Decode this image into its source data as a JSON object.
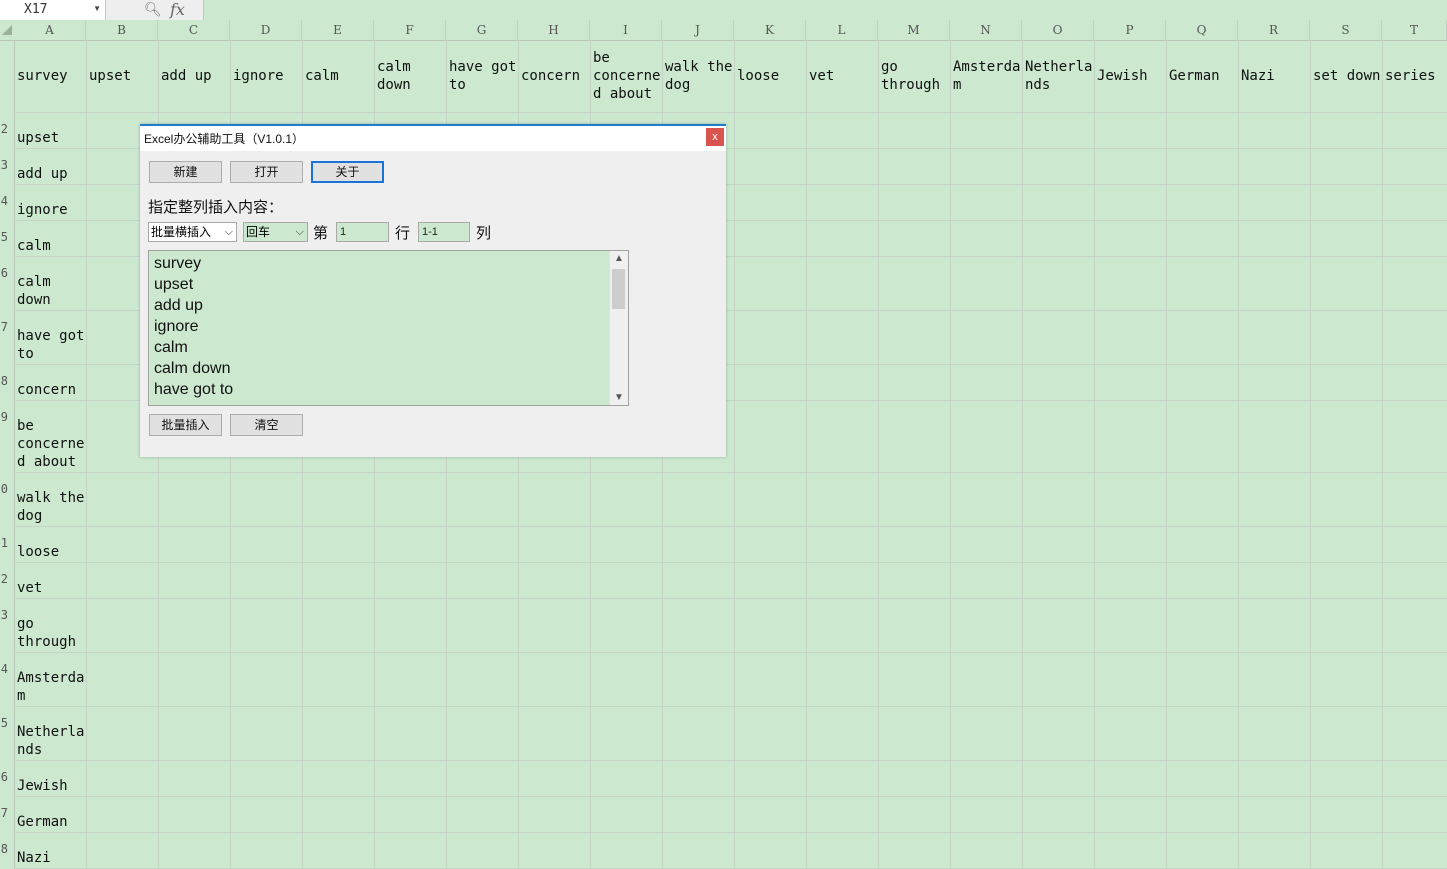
{
  "namebox": {
    "value": "X17"
  },
  "formula": {
    "fx_label": "fx"
  },
  "columns": [
    "A",
    "B",
    "C",
    "D",
    "E",
    "F",
    "G",
    "H",
    "I",
    "J",
    "K",
    "L",
    "M",
    "N",
    "O",
    "P",
    "Q",
    "R",
    "S",
    "T"
  ],
  "row_numbers": [
    "2",
    "3",
    "4",
    "5",
    "6",
    "7",
    "8",
    "9",
    "0",
    "1",
    "2",
    "3",
    "4",
    "5",
    "6",
    "7",
    "8"
  ],
  "header_row": [
    "upset",
    "add up",
    "ignore",
    "calm",
    "calm\ndown",
    "have got\nto",
    "concern",
    "be\nconcerne\nd about",
    "walk the\ndog",
    "loose",
    "vet",
    "go\nthrough",
    "Amsterda\nm",
    "Netherla\nnds",
    "Jewish",
    "German",
    "Nazi",
    "set down",
    "series"
  ],
  "column_a": [
    "survey",
    "upset",
    "add up",
    "ignore",
    "calm",
    "calm\ndown",
    "have got\nto",
    "concern",
    "be\nconcerne\nd about",
    "walk the\ndog",
    "loose",
    "vet",
    "go\nthrough",
    "Amsterda\nm",
    "Netherla\nnds",
    "Jewish",
    "German",
    "Nazi"
  ],
  "dialog": {
    "title": "Excel办公辅助工具（V1.0.1）",
    "close": "x",
    "new_btn": "新建",
    "open_btn": "打开",
    "about_btn": "关于",
    "section_label": "指定整列插入内容：",
    "mode_select": "批量横插入",
    "sep_select": "回车",
    "di": "第",
    "row_value": "1",
    "hang": "行",
    "col_value": "1-1",
    "lie": "列",
    "text_lines": [
      "survey",
      "upset",
      "add up",
      "ignore",
      "calm",
      "calm down",
      "have got to"
    ],
    "insert_btn": "批量插入",
    "clear_btn": "清空"
  }
}
